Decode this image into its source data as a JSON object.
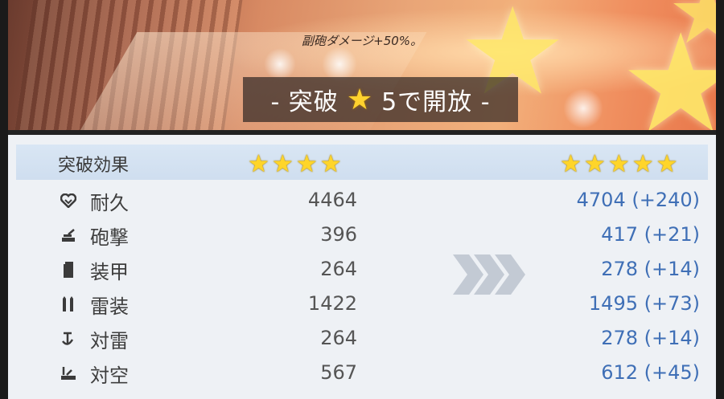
{
  "banner": {
    "effect_text": "副砲ダメージ+50%。",
    "unlock_prefix": "- 突破",
    "unlock_suffix": "5で開放 -"
  },
  "table": {
    "header_label": "突破効果",
    "before_star_count": 4,
    "after_star_count": 5,
    "rows": [
      {
        "icon": "heart-icon",
        "label": "耐久",
        "before": "4464",
        "after": "4704 (+240)"
      },
      {
        "icon": "gun-icon",
        "label": "砲撃",
        "before": "396",
        "after": "417 (+21)"
      },
      {
        "icon": "armor-icon",
        "label": "装甲",
        "before": "264",
        "after": "278 (+14)"
      },
      {
        "icon": "torpedo-icon",
        "label": "雷装",
        "before": "1422",
        "after": "1495 (+73)"
      },
      {
        "icon": "anchor-icon",
        "label": "対雷",
        "before": "264",
        "after": "278 (+14)"
      },
      {
        "icon": "anti-air-icon",
        "label": "対空",
        "before": "567",
        "after": "612 (+45)"
      }
    ]
  },
  "colors": {
    "star": "#ffd52a",
    "after_value": "#3f6fb6",
    "header_bg": "#d6e4f3"
  }
}
